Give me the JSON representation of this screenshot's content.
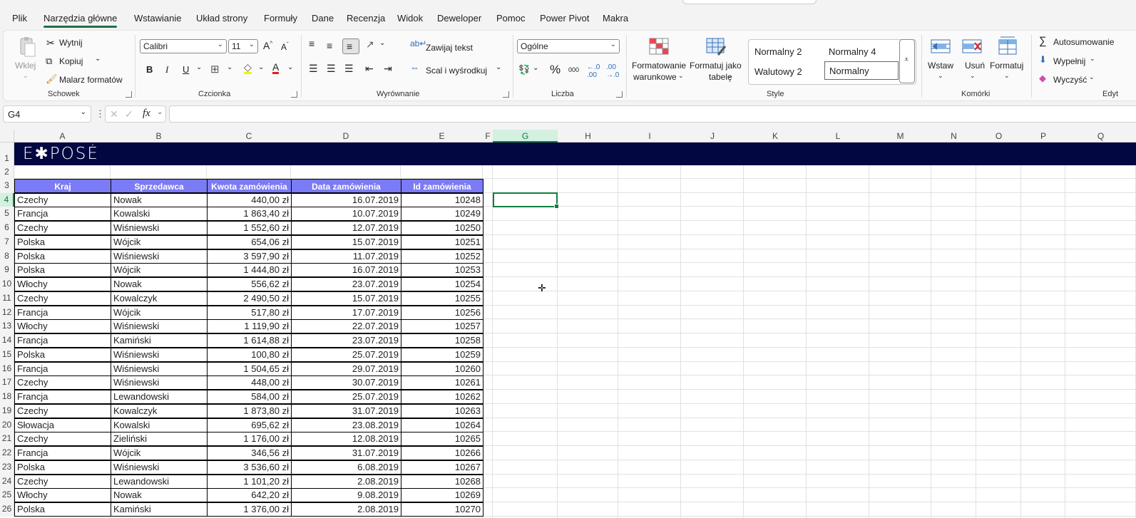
{
  "tabs": [
    "Plik",
    "Narzędzia główne",
    "Wstawianie",
    "Układ strony",
    "Formuły",
    "Dane",
    "Recenzja",
    "Widok",
    "Deweloper",
    "Pomoc",
    "Power Pivot",
    "Makra"
  ],
  "ribbon": {
    "clipboard": {
      "paste": "Wklej",
      "cut": "Wytnij",
      "copy": "Kopiuj",
      "painter": "Malarz formatów",
      "label": "Schowek"
    },
    "font": {
      "name": "Calibri",
      "size": "11",
      "label": "Czcionka",
      "bold": "B",
      "italic": "I",
      "underline": "U"
    },
    "alignment": {
      "wrap": "Zawijaj tekst",
      "merge": "Scal i wyśrodkuj",
      "label": "Wyrównanie"
    },
    "number": {
      "format": "Ogólne",
      "percent": "%",
      "thousands": "000",
      "label": "Liczba"
    },
    "styles": {
      "cond": "Formatowanie",
      "cond2": "warunkowe",
      "table": "Formatuj jako",
      "table2": "tabelę",
      "s1": "Normalny 2",
      "s2": "Normalny 4",
      "s3": "Walutowy 2",
      "s4": "Normalny",
      "label": "Style"
    },
    "cells": {
      "insert": "Wstaw",
      "delete": "Usuń",
      "format": "Formatuj",
      "label": "Komórki"
    },
    "editing": {
      "autosum": "Autosumowanie",
      "fill": "Wypełnij",
      "clear": "Wyczyść",
      "label": "Edyt"
    }
  },
  "formula_bar": {
    "name_box": "G4",
    "fx": "fx",
    "value": ""
  },
  "columns": [
    "A",
    "B",
    "C",
    "D",
    "E",
    "F",
    "G",
    "H",
    "I",
    "J",
    "K",
    "L",
    "M",
    "N",
    "O",
    "P",
    "Q"
  ],
  "rows": [
    "1",
    "2",
    "3",
    "4",
    "5",
    "6",
    "7",
    "8",
    "9",
    "10",
    "11",
    "12",
    "13",
    "14",
    "15",
    "16",
    "17",
    "18",
    "19",
    "20",
    "21",
    "22",
    "23",
    "24",
    "25",
    "26"
  ],
  "logo_text": "E✱POSĖ",
  "table": {
    "headers": [
      "Kraj",
      "Sprzedawca",
      "Kwota zamówienia",
      "Data zamówienia",
      "Id zamówienia"
    ],
    "rows": [
      [
        "Czechy",
        "Nowak",
        "440,00 zł",
        "16.07.2019",
        "10248"
      ],
      [
        "Francja",
        "Kowalski",
        "1 863,40 zł",
        "10.07.2019",
        "10249"
      ],
      [
        "Czechy",
        "Wiśniewski",
        "1 552,60 zł",
        "12.07.2019",
        "10250"
      ],
      [
        "Polska",
        "Wójcik",
        "654,06 zł",
        "15.07.2019",
        "10251"
      ],
      [
        "Polska",
        "Wiśniewski",
        "3 597,90 zł",
        "11.07.2019",
        "10252"
      ],
      [
        "Polska",
        "Wójcik",
        "1 444,80 zł",
        "16.07.2019",
        "10253"
      ],
      [
        "Włochy",
        "Nowak",
        "556,62 zł",
        "23.07.2019",
        "10254"
      ],
      [
        "Czechy",
        "Kowalczyk",
        "2 490,50 zł",
        "15.07.2019",
        "10255"
      ],
      [
        "Francja",
        "Wójcik",
        "517,80 zł",
        "17.07.2019",
        "10256"
      ],
      [
        "Włochy",
        "Wiśniewski",
        "1 119,90 zł",
        "22.07.2019",
        "10257"
      ],
      [
        "Francja",
        "Kamiński",
        "1 614,88 zł",
        "23.07.2019",
        "10258"
      ],
      [
        "Polska",
        "Wiśniewski",
        "100,80 zł",
        "25.07.2019",
        "10259"
      ],
      [
        "Francja",
        "Wiśniewski",
        "1 504,65 zł",
        "29.07.2019",
        "10260"
      ],
      [
        "Czechy",
        "Wiśniewski",
        "448,00 zł",
        "30.07.2019",
        "10261"
      ],
      [
        "Francja",
        "Lewandowski",
        "584,00 zł",
        "25.07.2019",
        "10262"
      ],
      [
        "Czechy",
        "Kowalczyk",
        "1 873,80 zł",
        "31.07.2019",
        "10263"
      ],
      [
        "Słowacja",
        "Kowalski",
        "695,62 zł",
        "23.08.2019",
        "10264"
      ],
      [
        "Czechy",
        "Zieliński",
        "1 176,00 zł",
        "12.08.2019",
        "10265"
      ],
      [
        "Francja",
        "Wójcik",
        "346,56 zł",
        "31.07.2019",
        "10266"
      ],
      [
        "Polska",
        "Wiśniewski",
        "3 536,60 zł",
        "6.08.2019",
        "10267"
      ],
      [
        "Czechy",
        "Lewandowski",
        "1 101,20 zł",
        "2.08.2019",
        "10268"
      ],
      [
        "Włochy",
        "Nowak",
        "642,20 zł",
        "9.08.2019",
        "10269"
      ],
      [
        "Polska",
        "Kamiński",
        "1 376,00 zł",
        "2.08.2019",
        "10270"
      ]
    ]
  }
}
